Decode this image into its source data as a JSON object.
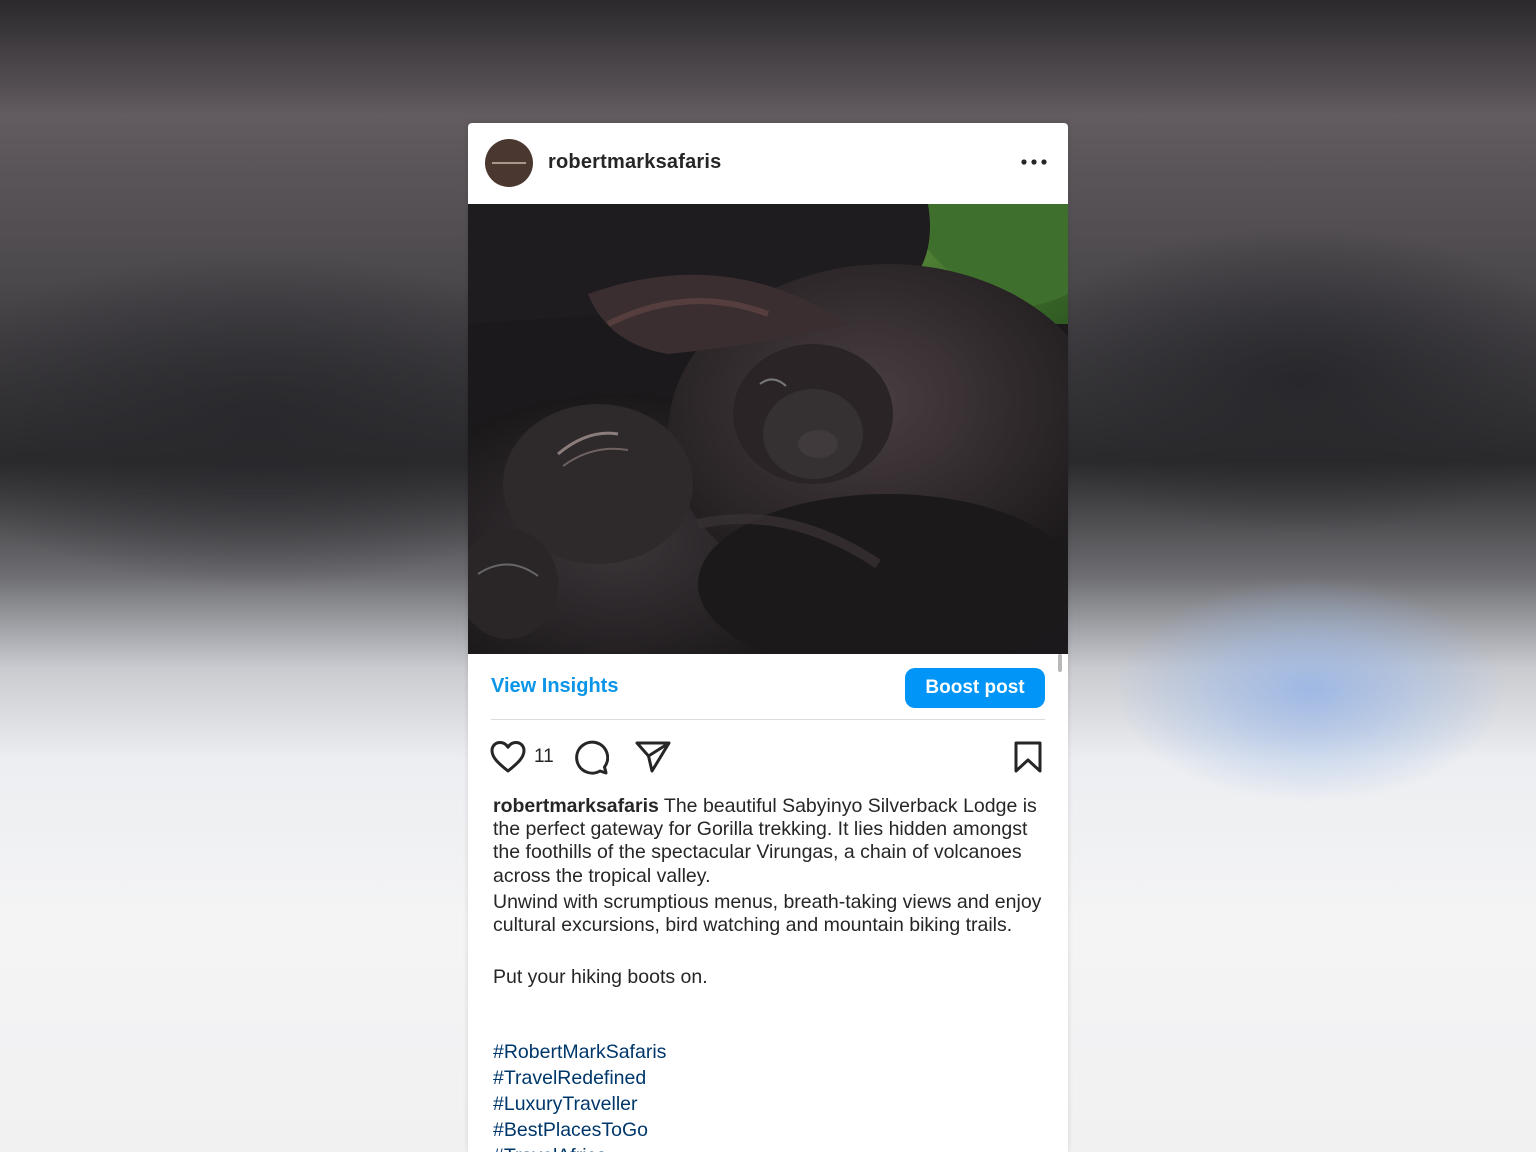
{
  "post": {
    "username": "robertmarksafaris",
    "more_icon": "more-horizontal-icon",
    "avatar_icon": "brand-logo"
  },
  "insights_bar": {
    "view_insights": "View Insights",
    "boost_post": "Boost post",
    "accent_color": "#0095f6"
  },
  "actions": {
    "like_icon": "heart-icon",
    "like_count": "11",
    "comment_icon": "comment-icon",
    "share_icon": "send-icon",
    "save_icon": "bookmark-icon"
  },
  "caption": {
    "username": "robertmarksafaris",
    "paragraph1": "The beautiful Sabyinyo Silverback Lodge is the perfect gateway for Gorilla trekking. It lies hidden amongst the foothills of the spectacular Virungas, a chain of volcanoes across the tropical valley.",
    "paragraph2": "Unwind with scrumptious menus, breath-taking views and enjoy cultural excursions, bird watching and mountain biking trails.",
    "paragraph3": "Put your hiking boots on.",
    "hashtags": [
      "#RobertMarkSafaris",
      "#TravelRedefined",
      "#LuxuryTraveller",
      "#BestPlacesToGo",
      "#TravelAfrica"
    ],
    "hashtag_color": "#00376b"
  }
}
